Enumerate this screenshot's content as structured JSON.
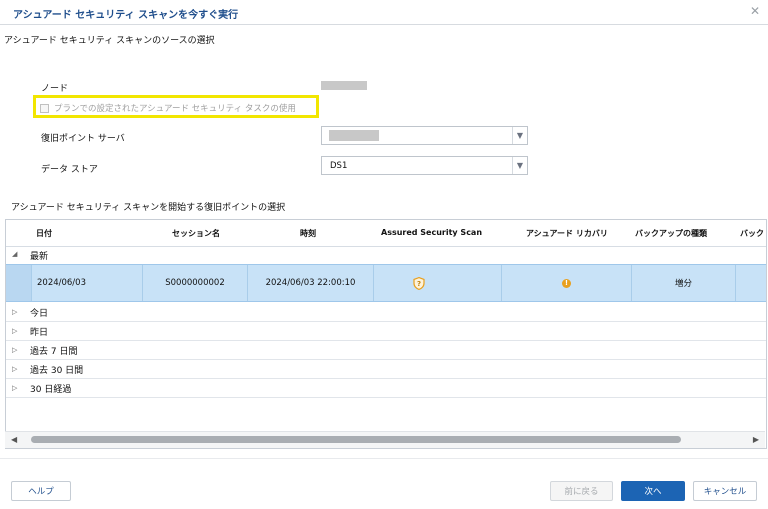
{
  "dialog": {
    "title": "アシュアード セキュリティ スキャンを今すぐ実行",
    "close_icon": "close-icon"
  },
  "source_section": {
    "heading": "アシュアード セキュリティ スキャンのソースの選択",
    "node_label": "ノード",
    "checkbox_label": "プランでの設定されたアシュアード セキュリティ タスクの使用",
    "checkbox_checked": false,
    "rps_label": "復旧ポイント サーバ",
    "datastore_label": "データ ストア",
    "datastore_value": "DS1"
  },
  "recovery_section": {
    "heading": "アシュアード セキュリティ スキャンを開始する復旧ポイントの選択",
    "columns": [
      "日付",
      "セッション名",
      "時刻",
      "Assured Security Scan",
      "アシュアード リカバリ",
      "バックアップの種類",
      "バック"
    ],
    "group_latest": "最新",
    "selected_row": {
      "date": "2024/06/03",
      "session": "S0000000002",
      "time": "2024/06/03 22:00:10",
      "scan_icon": "shield-question-icon",
      "recovery_icon": "warning-icon",
      "backup_type": "増分"
    },
    "groups": [
      "今日",
      "昨日",
      "過去 7 日間",
      "過去 30 日間",
      "30 日経過"
    ]
  },
  "buttons": {
    "help": "ヘルプ",
    "back": "前に戻る",
    "next": "次へ",
    "cancel": "キャンセル"
  },
  "colors": {
    "title": "#1f4e8c",
    "highlight": "#f2e600",
    "selected_row": "#c8e2f7",
    "primary_button": "#1c64b4",
    "warning": "#e8a01f"
  }
}
